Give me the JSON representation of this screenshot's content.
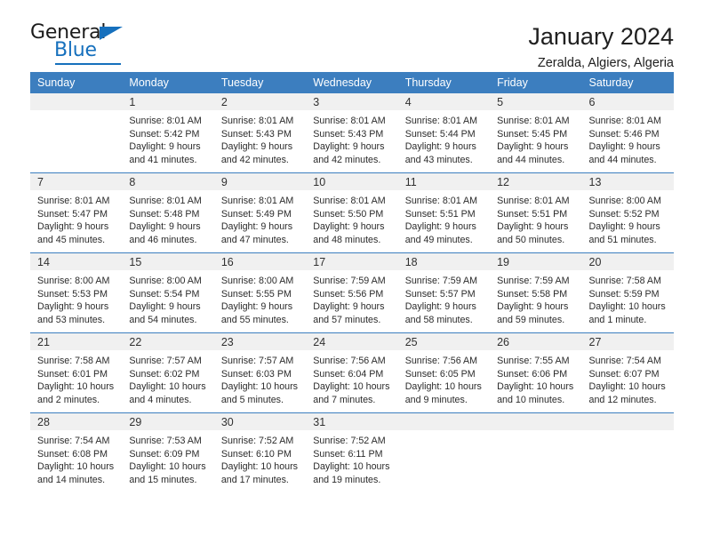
{
  "brand": {
    "name_primary": "General",
    "name_secondary": "Blue",
    "accent_color": "#1670bd"
  },
  "header": {
    "title": "January 2024",
    "subtitle": "Zeralda, Algiers, Algeria"
  },
  "calendar": {
    "header_bg": "#3c7ebf",
    "daynum_bg": "#f0f0f0",
    "weekday_headers": [
      "Sunday",
      "Monday",
      "Tuesday",
      "Wednesday",
      "Thursday",
      "Friday",
      "Saturday"
    ],
    "weeks": [
      [
        {
          "day": "",
          "sunrise": "",
          "sunset": "",
          "daylight1": "",
          "daylight2": "",
          "empty": true
        },
        {
          "day": "1",
          "sunrise": "Sunrise: 8:01 AM",
          "sunset": "Sunset: 5:42 PM",
          "daylight1": "Daylight: 9 hours",
          "daylight2": "and 41 minutes."
        },
        {
          "day": "2",
          "sunrise": "Sunrise: 8:01 AM",
          "sunset": "Sunset: 5:43 PM",
          "daylight1": "Daylight: 9 hours",
          "daylight2": "and 42 minutes."
        },
        {
          "day": "3",
          "sunrise": "Sunrise: 8:01 AM",
          "sunset": "Sunset: 5:43 PM",
          "daylight1": "Daylight: 9 hours",
          "daylight2": "and 42 minutes."
        },
        {
          "day": "4",
          "sunrise": "Sunrise: 8:01 AM",
          "sunset": "Sunset: 5:44 PM",
          "daylight1": "Daylight: 9 hours",
          "daylight2": "and 43 minutes."
        },
        {
          "day": "5",
          "sunrise": "Sunrise: 8:01 AM",
          "sunset": "Sunset: 5:45 PM",
          "daylight1": "Daylight: 9 hours",
          "daylight2": "and 44 minutes."
        },
        {
          "day": "6",
          "sunrise": "Sunrise: 8:01 AM",
          "sunset": "Sunset: 5:46 PM",
          "daylight1": "Daylight: 9 hours",
          "daylight2": "and 44 minutes."
        }
      ],
      [
        {
          "day": "7",
          "sunrise": "Sunrise: 8:01 AM",
          "sunset": "Sunset: 5:47 PM",
          "daylight1": "Daylight: 9 hours",
          "daylight2": "and 45 minutes."
        },
        {
          "day": "8",
          "sunrise": "Sunrise: 8:01 AM",
          "sunset": "Sunset: 5:48 PM",
          "daylight1": "Daylight: 9 hours",
          "daylight2": "and 46 minutes."
        },
        {
          "day": "9",
          "sunrise": "Sunrise: 8:01 AM",
          "sunset": "Sunset: 5:49 PM",
          "daylight1": "Daylight: 9 hours",
          "daylight2": "and 47 minutes."
        },
        {
          "day": "10",
          "sunrise": "Sunrise: 8:01 AM",
          "sunset": "Sunset: 5:50 PM",
          "daylight1": "Daylight: 9 hours",
          "daylight2": "and 48 minutes."
        },
        {
          "day": "11",
          "sunrise": "Sunrise: 8:01 AM",
          "sunset": "Sunset: 5:51 PM",
          "daylight1": "Daylight: 9 hours",
          "daylight2": "and 49 minutes."
        },
        {
          "day": "12",
          "sunrise": "Sunrise: 8:01 AM",
          "sunset": "Sunset: 5:51 PM",
          "daylight1": "Daylight: 9 hours",
          "daylight2": "and 50 minutes."
        },
        {
          "day": "13",
          "sunrise": "Sunrise: 8:00 AM",
          "sunset": "Sunset: 5:52 PM",
          "daylight1": "Daylight: 9 hours",
          "daylight2": "and 51 minutes."
        }
      ],
      [
        {
          "day": "14",
          "sunrise": "Sunrise: 8:00 AM",
          "sunset": "Sunset: 5:53 PM",
          "daylight1": "Daylight: 9 hours",
          "daylight2": "and 53 minutes."
        },
        {
          "day": "15",
          "sunrise": "Sunrise: 8:00 AM",
          "sunset": "Sunset: 5:54 PM",
          "daylight1": "Daylight: 9 hours",
          "daylight2": "and 54 minutes."
        },
        {
          "day": "16",
          "sunrise": "Sunrise: 8:00 AM",
          "sunset": "Sunset: 5:55 PM",
          "daylight1": "Daylight: 9 hours",
          "daylight2": "and 55 minutes."
        },
        {
          "day": "17",
          "sunrise": "Sunrise: 7:59 AM",
          "sunset": "Sunset: 5:56 PM",
          "daylight1": "Daylight: 9 hours",
          "daylight2": "and 57 minutes."
        },
        {
          "day": "18",
          "sunrise": "Sunrise: 7:59 AM",
          "sunset": "Sunset: 5:57 PM",
          "daylight1": "Daylight: 9 hours",
          "daylight2": "and 58 minutes."
        },
        {
          "day": "19",
          "sunrise": "Sunrise: 7:59 AM",
          "sunset": "Sunset: 5:58 PM",
          "daylight1": "Daylight: 9 hours",
          "daylight2": "and 59 minutes."
        },
        {
          "day": "20",
          "sunrise": "Sunrise: 7:58 AM",
          "sunset": "Sunset: 5:59 PM",
          "daylight1": "Daylight: 10 hours",
          "daylight2": "and 1 minute."
        }
      ],
      [
        {
          "day": "21",
          "sunrise": "Sunrise: 7:58 AM",
          "sunset": "Sunset: 6:01 PM",
          "daylight1": "Daylight: 10 hours",
          "daylight2": "and 2 minutes."
        },
        {
          "day": "22",
          "sunrise": "Sunrise: 7:57 AM",
          "sunset": "Sunset: 6:02 PM",
          "daylight1": "Daylight: 10 hours",
          "daylight2": "and 4 minutes."
        },
        {
          "day": "23",
          "sunrise": "Sunrise: 7:57 AM",
          "sunset": "Sunset: 6:03 PM",
          "daylight1": "Daylight: 10 hours",
          "daylight2": "and 5 minutes."
        },
        {
          "day": "24",
          "sunrise": "Sunrise: 7:56 AM",
          "sunset": "Sunset: 6:04 PM",
          "daylight1": "Daylight: 10 hours",
          "daylight2": "and 7 minutes."
        },
        {
          "day": "25",
          "sunrise": "Sunrise: 7:56 AM",
          "sunset": "Sunset: 6:05 PM",
          "daylight1": "Daylight: 10 hours",
          "daylight2": "and 9 minutes."
        },
        {
          "day": "26",
          "sunrise": "Sunrise: 7:55 AM",
          "sunset": "Sunset: 6:06 PM",
          "daylight1": "Daylight: 10 hours",
          "daylight2": "and 10 minutes."
        },
        {
          "day": "27",
          "sunrise": "Sunrise: 7:54 AM",
          "sunset": "Sunset: 6:07 PM",
          "daylight1": "Daylight: 10 hours",
          "daylight2": "and 12 minutes."
        }
      ],
      [
        {
          "day": "28",
          "sunrise": "Sunrise: 7:54 AM",
          "sunset": "Sunset: 6:08 PM",
          "daylight1": "Daylight: 10 hours",
          "daylight2": "and 14 minutes."
        },
        {
          "day": "29",
          "sunrise": "Sunrise: 7:53 AM",
          "sunset": "Sunset: 6:09 PM",
          "daylight1": "Daylight: 10 hours",
          "daylight2": "and 15 minutes."
        },
        {
          "day": "30",
          "sunrise": "Sunrise: 7:52 AM",
          "sunset": "Sunset: 6:10 PM",
          "daylight1": "Daylight: 10 hours",
          "daylight2": "and 17 minutes."
        },
        {
          "day": "31",
          "sunrise": "Sunrise: 7:52 AM",
          "sunset": "Sunset: 6:11 PM",
          "daylight1": "Daylight: 10 hours",
          "daylight2": "and 19 minutes."
        },
        {
          "day": "",
          "sunrise": "",
          "sunset": "",
          "daylight1": "",
          "daylight2": "",
          "empty": true
        },
        {
          "day": "",
          "sunrise": "",
          "sunset": "",
          "daylight1": "",
          "daylight2": "",
          "empty": true
        },
        {
          "day": "",
          "sunrise": "",
          "sunset": "",
          "daylight1": "",
          "daylight2": "",
          "empty": true
        }
      ]
    ]
  }
}
